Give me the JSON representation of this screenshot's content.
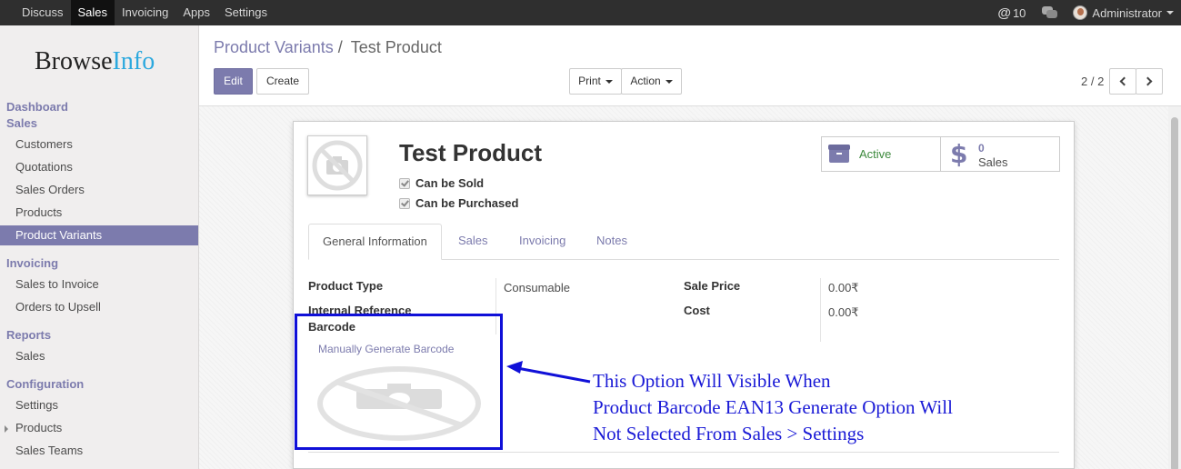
{
  "topbar": {
    "menu": [
      "Discuss",
      "Sales",
      "Invoicing",
      "Apps",
      "Settings"
    ],
    "active_menu": "Sales",
    "mentions_count": "10",
    "user_name": "Administrator"
  },
  "logo": {
    "part1": "Browse",
    "part2": "Info"
  },
  "sidebar": {
    "dashboard": "Dashboard",
    "sales_head": "Sales",
    "sales_items": [
      "Customers",
      "Quotations",
      "Sales Orders",
      "Products",
      "Product Variants"
    ],
    "invoicing_head": "Invoicing",
    "invoicing_items": [
      "Sales to Invoice",
      "Orders to Upsell"
    ],
    "reports_head": "Reports",
    "reports_items": [
      "Sales"
    ],
    "config_head": "Configuration",
    "config_items": [
      "Settings",
      "Products",
      "Sales Teams"
    ]
  },
  "breadcrumb": {
    "parent": "Product Variants",
    "separator": "/",
    "current": "Test Product"
  },
  "buttons": {
    "edit": "Edit",
    "create": "Create",
    "print": "Print",
    "action": "Action"
  },
  "pager": {
    "value": "2 / 2"
  },
  "product": {
    "name": "Test Product",
    "can_be_sold_label": "Can be Sold",
    "can_be_purchased_label": "Can be Purchased",
    "status": "Active",
    "sales_count": "0",
    "sales_label": "Sales"
  },
  "tabs": [
    "General Information",
    "Sales",
    "Invoicing",
    "Notes"
  ],
  "fields": {
    "product_type_label": "Product Type",
    "product_type_value": "Consumable",
    "internal_ref_label": "Internal Reference",
    "barcode_label": "Barcode",
    "barcode_link": "Manually Generate Barcode",
    "sale_price_label": "Sale Price",
    "sale_price_value": "0.00₹",
    "cost_label": "Cost",
    "cost_value": "0.00₹"
  },
  "annotation": {
    "line1": "This Option Will Visible When",
    "line2": "Product Barcode EAN13 Generate Option Will",
    "line3": "Not Selected From Sales > Settings"
  },
  "colors": {
    "brand": "#7c7bad",
    "annotation": "#1a1ad6",
    "active_status": "#3d8a3d"
  }
}
